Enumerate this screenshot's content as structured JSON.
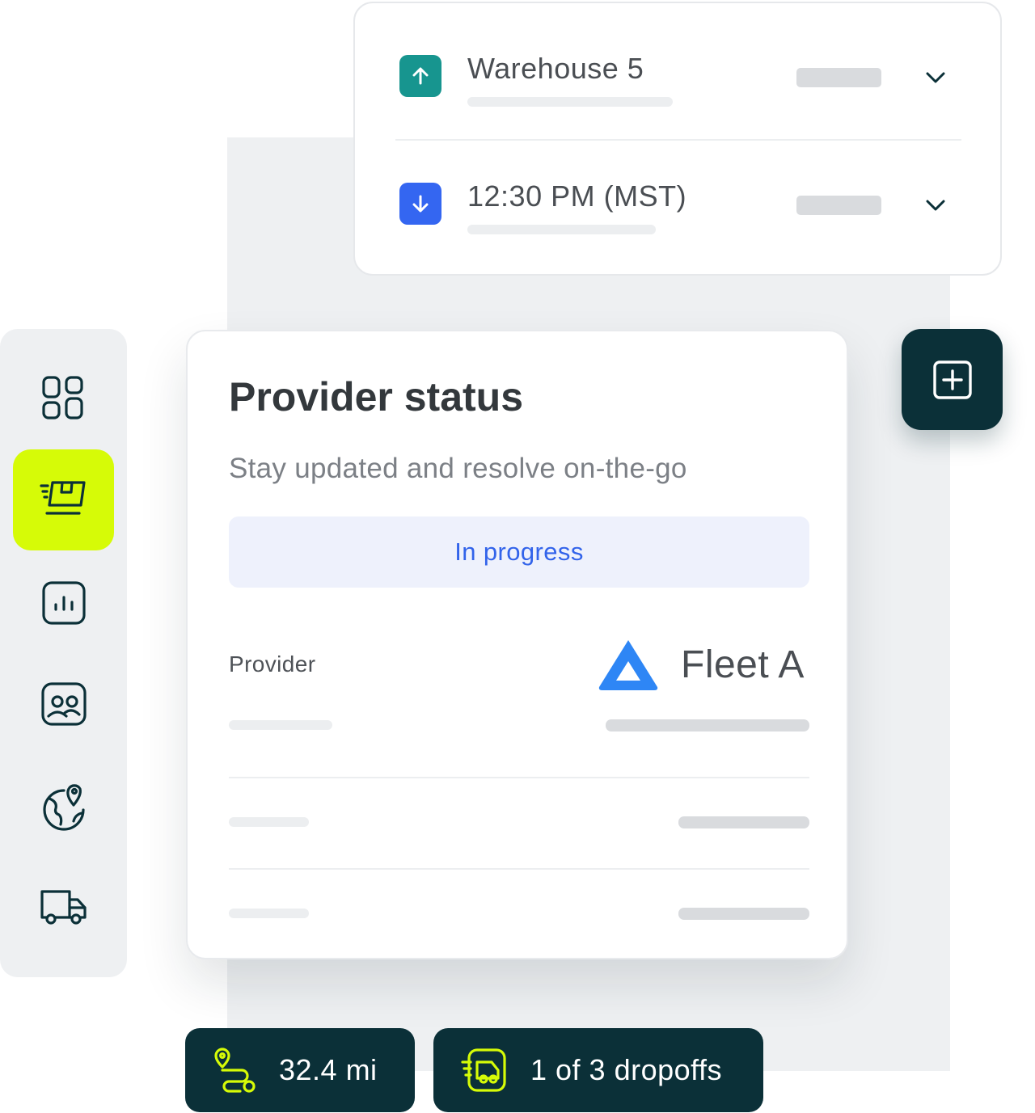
{
  "pickup": {
    "title": "Warehouse 5",
    "icon": "arrow-up-icon",
    "color": "#17958f"
  },
  "dropoff": {
    "title": "12:30 PM (MST)",
    "icon": "arrow-down-icon",
    "color": "#3466f1"
  },
  "sidebar": {
    "items": [
      {
        "name": "dashboard",
        "icon": "grid-icon",
        "active": false
      },
      {
        "name": "deliveries",
        "icon": "delivery-box-icon",
        "active": true
      },
      {
        "name": "analytics",
        "icon": "chart-icon",
        "active": false
      },
      {
        "name": "drivers",
        "icon": "people-icon",
        "active": false
      },
      {
        "name": "map",
        "icon": "globe-pin-icon",
        "active": false
      },
      {
        "name": "fleet",
        "icon": "truck-icon",
        "active": false
      }
    ],
    "active_color": "#d6fb07"
  },
  "card": {
    "title": "Provider status",
    "subtitle": "Stay updated and resolve on-the-go",
    "status": "In progress",
    "provider_label": "Provider",
    "provider_name": "Fleet A",
    "provider_logo": "fleet-a-logo",
    "accent": "#3263ea"
  },
  "fab": {
    "icon": "add-square-icon"
  },
  "chips": {
    "distance": "32.4 mi",
    "distance_icon": "route-icon",
    "dropoffs": "1 of 3 dropoffs",
    "dropoffs_icon": "delivery-truck-icon",
    "color": "#0b3038",
    "icon_color": "#d6fb07"
  }
}
